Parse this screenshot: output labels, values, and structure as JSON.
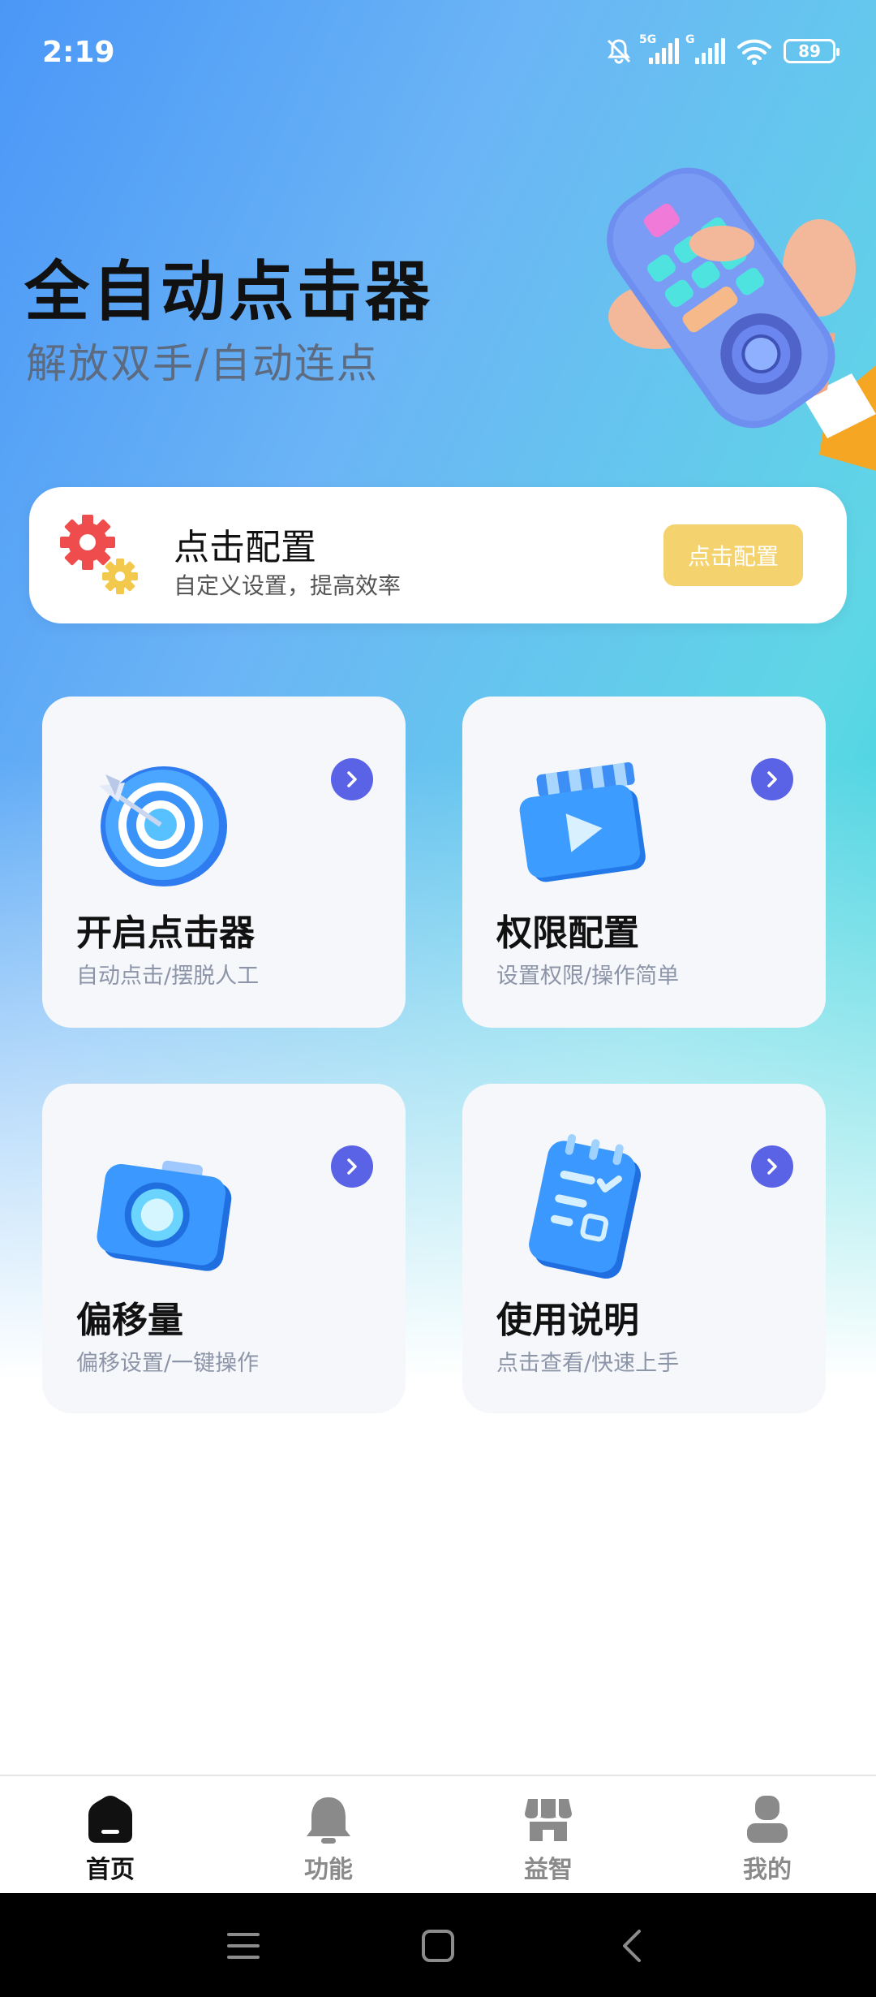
{
  "status_bar": {
    "time": "2:19",
    "battery": "89",
    "signal_1_tag": "5G",
    "signal_2_tag": "G",
    "icons": [
      "mute-bell-icon",
      "signal-5g-icon",
      "signal-g-icon",
      "wifi-icon",
      "battery-icon"
    ]
  },
  "hero": {
    "title": "全自动点击器",
    "subtitle": "解放双手/自动连点"
  },
  "config_card": {
    "title": "点击配置",
    "subtitle": "自定义设置，提高效率",
    "button_label": "点击配置",
    "button_color": "#f4d36e"
  },
  "features": [
    {
      "title": "开启点击器",
      "subtitle": "自动点击/摆脱人工",
      "icon": "target-icon"
    },
    {
      "title": "权限配置",
      "subtitle": "设置权限/操作简单",
      "icon": "video-clapper-icon"
    },
    {
      "title": "偏移量",
      "subtitle": "偏移设置/一键操作",
      "icon": "camera-icon"
    },
    {
      "title": "使用说明",
      "subtitle": "点击查看/快速上手",
      "icon": "notebook-icon"
    }
  ],
  "bottom_nav": {
    "items": [
      {
        "label": "首页",
        "icon": "home-icon",
        "active": true
      },
      {
        "label": "功能",
        "icon": "bell-icon",
        "active": false
      },
      {
        "label": "益智",
        "icon": "store-icon",
        "active": false
      },
      {
        "label": "我的",
        "icon": "user-icon",
        "active": false
      }
    ]
  },
  "colors": {
    "accent": "#5a63e6",
    "gradient_start": "#4a97f7",
    "gradient_end": "#2fd3d9"
  }
}
